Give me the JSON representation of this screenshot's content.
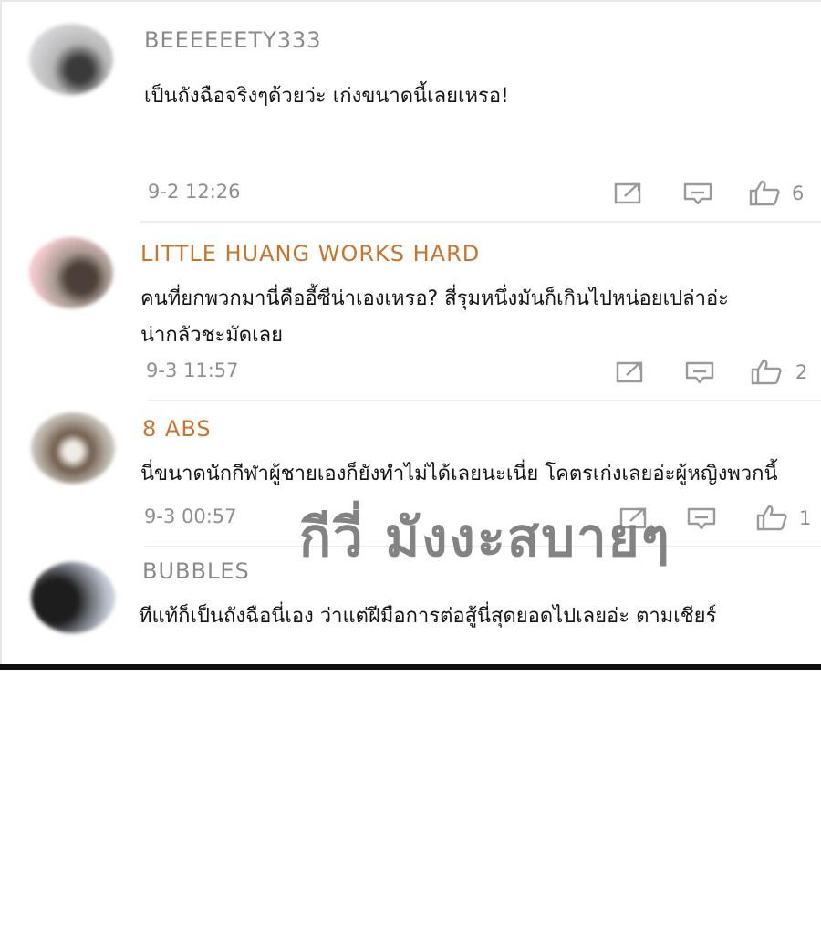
{
  "comments": [
    {
      "username": "BEEEEEETY333",
      "username_color": "#8a8a8a",
      "lines": [
        "เป็นถังฉือจริงๆด้วยว่ะ เก่งขนาดนี้เลยเหรอ!"
      ],
      "timestamp": "9-2 12:26",
      "likes": "6"
    },
    {
      "username": "LITTLE HUANG WORKS HARD",
      "username_color": "#c8742e",
      "lines": [
        "คนที่ยกพวกมานี่คืออี้ซีน่าเองเหรอ? สี่รุมหนึ่งมันก็เกินไปหน่อยเปล่าอ่ะ",
        "น่ากลัวชะมัดเลย"
      ],
      "timestamp": "9-3 11:57",
      "likes": "2"
    },
    {
      "username": "8 ABS",
      "username_color": "#c8742e",
      "lines": [
        "นี่ขนาดนักกีฬาผู้ชายเองก็ยังทำไม่ได้เลยนะเนี่ย โคตรเก่งเลยอ่ะผู้หญิงพวกนี้"
      ],
      "timestamp": "9-3 00:57",
      "likes": "1"
    },
    {
      "username": "BUBBLES",
      "username_color": "#8a8a8a",
      "lines": [
        "ทีแท้ก็เป็นถังฉือนี่เอง ว่าแต่ฝีมือการต่อสู้นี่สุดยอดไปเลยอ่ะ ตามเชียร์"
      ]
    }
  ],
  "watermark": "กีวี่ มังงะสบายๆ",
  "icons": {
    "share": "share-icon",
    "reply": "comment-icon",
    "like": "thumbs-up-icon"
  },
  "colors": {
    "timestamp": "#8f8f8f",
    "icon": "#9a9a9a",
    "watermark": "#7d7d7d"
  }
}
